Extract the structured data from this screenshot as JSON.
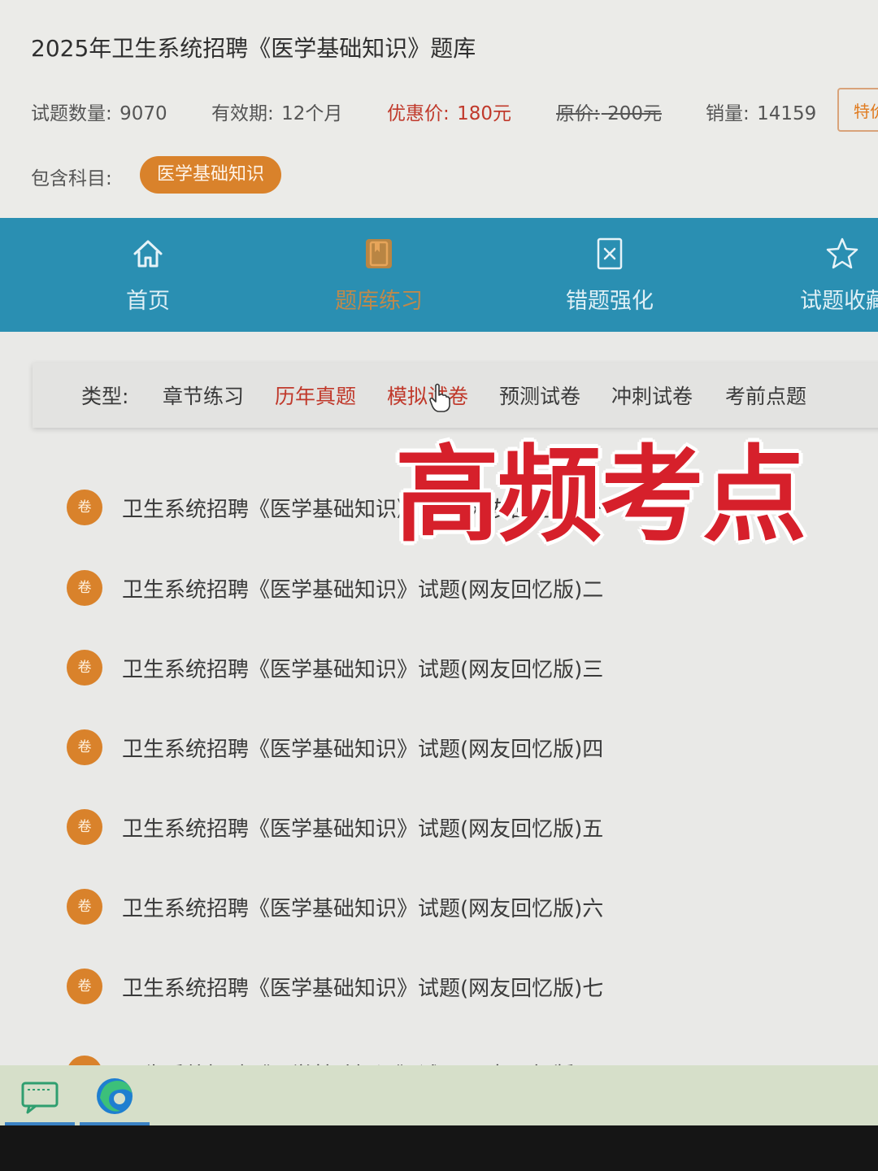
{
  "header": {
    "title": "2025年卫生系统招聘《医学基础知识》题库",
    "question_count_label": "试题数量:",
    "question_count": "9070",
    "validity_label": "有效期:",
    "validity": "12个月",
    "price_label": "优惠价:",
    "price": "180元",
    "original_price_label": "原价:",
    "original_price": "200元",
    "sales_label": "销量:",
    "sales": "14159",
    "special_button": "特价",
    "subjects_label": "包含科目:",
    "subject": "医学基础知识"
  },
  "nav": {
    "items": [
      {
        "label": "首页",
        "icon": "home-icon"
      },
      {
        "label": "题库练习",
        "icon": "book-icon"
      },
      {
        "label": "错题强化",
        "icon": "wrong-question-icon"
      },
      {
        "label": "试题收藏",
        "icon": "star-icon"
      }
    ],
    "active": "题库练习"
  },
  "type_filter": {
    "label": "类型:",
    "options": [
      "章节练习",
      "历年真题",
      "模拟试卷",
      "预测试卷",
      "冲刺试卷",
      "考前点题"
    ]
  },
  "exams": {
    "badge": "卷",
    "items": [
      "卫生系统招聘《医学基础知识》试题(网友回忆版)一",
      "卫生系统招聘《医学基础知识》试题(网友回忆版)二",
      "卫生系统招聘《医学基础知识》试题(网友回忆版)三",
      "卫生系统招聘《医学基础知识》试题(网友回忆版)四",
      "卫生系统招聘《医学基础知识》试题(网友回忆版)五",
      "卫生系统招聘《医学基础知识》试题(网友回忆版)六",
      "卫生系统招聘《医学基础知识》试题(网友回忆版)七",
      "卫生系统招聘《医学基础知识》试题(网友回忆版)八"
    ]
  },
  "overlay_text": "高频考点",
  "taskbar": {
    "apps": [
      "chat-app-icon",
      "edge-browser-icon"
    ]
  },
  "colors": {
    "nav_bg": "#2a8fb2",
    "accent_orange": "#d9822b",
    "price_red": "#c0392b",
    "overlay_red": "#d6202b"
  }
}
